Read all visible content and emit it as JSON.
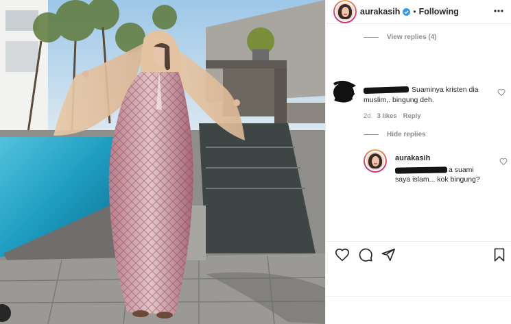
{
  "post": {
    "username": "aurakasih",
    "follow_status": "Following",
    "more_icon": "more-options-icon"
  },
  "comments": {
    "view_replies_label": "View replies (4)",
    "comment1": {
      "text": "Suaminya kristen dia muslim,. bingung deh.",
      "time": "2d",
      "likes": "3 likes",
      "reply_label": "Reply"
    },
    "hide_replies_label": "Hide replies",
    "reply1": {
      "username": "aurakasih",
      "text": "a suami saya islam... kok bingung?"
    }
  },
  "actions": [
    "heart-icon",
    "comment-icon",
    "share-icon",
    "bookmark-icon"
  ],
  "colors": {
    "text": "#262626",
    "muted": "#8e8e8e",
    "divider": "#efefef",
    "pool": "#2aa6c8"
  }
}
